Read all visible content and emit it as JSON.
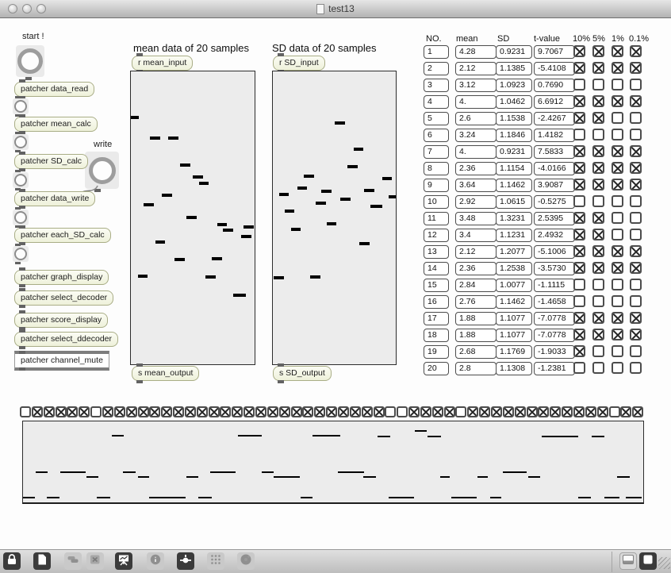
{
  "window": {
    "title": "test13"
  },
  "left": {
    "start_label": "start !",
    "write_label": "write",
    "chain": [
      "patcher data_read",
      "patcher mean_calc",
      "patcher SD_calc",
      "patcher data_write",
      "patcher each_SD_calc"
    ],
    "display": [
      "patcher graph_display",
      "patcher select_decoder",
      "patcher score_display",
      "patcher select_ddecoder",
      "patcher channel_mute"
    ]
  },
  "mean_graph": {
    "title": "mean data of 20 samples",
    "input_box": "r mean_input",
    "output_box": "s mean_output",
    "dashes": [
      [
        0,
        56,
        10
      ],
      [
        24,
        82,
        13
      ],
      [
        47,
        82,
        13
      ],
      [
        62,
        116,
        13
      ],
      [
        78,
        131,
        13
      ],
      [
        86,
        139,
        12
      ],
      [
        39,
        154,
        13
      ],
      [
        16,
        166,
        13
      ],
      [
        70,
        182,
        13
      ],
      [
        109,
        191,
        12
      ],
      [
        116,
        198,
        13
      ],
      [
        142,
        194,
        13
      ],
      [
        139,
        206,
        13
      ],
      [
        31,
        213,
        12
      ],
      [
        55,
        235,
        13
      ],
      [
        102,
        234,
        13
      ],
      [
        9,
        256,
        12
      ],
      [
        94,
        257,
        13
      ],
      [
        129,
        280,
        16
      ]
    ]
  },
  "sd_graph": {
    "title": "SD data of 20 samples",
    "input_box": "r SD_input",
    "output_box": "s SD_output",
    "dashes": [
      [
        78,
        63,
        13
      ],
      [
        102,
        96,
        12
      ],
      [
        94,
        118,
        13
      ],
      [
        39,
        130,
        13
      ],
      [
        138,
        133,
        12
      ],
      [
        31,
        145,
        12
      ],
      [
        61,
        149,
        13
      ],
      [
        115,
        148,
        13
      ],
      [
        8,
        153,
        12
      ],
      [
        146,
        156,
        9
      ],
      [
        85,
        159,
        13
      ],
      [
        54,
        164,
        13
      ],
      [
        123,
        168,
        15
      ],
      [
        15,
        174,
        12
      ],
      [
        68,
        190,
        12
      ],
      [
        23,
        197,
        12
      ],
      [
        109,
        215,
        13
      ],
      [
        1,
        258,
        13
      ],
      [
        47,
        257,
        13
      ]
    ]
  },
  "table": {
    "headers": [
      "NO.",
      "mean",
      "SD",
      "t-value",
      "10%",
      "5%",
      "1%",
      "0.1%"
    ],
    "rows": [
      {
        "no": "1",
        "mean": "4.28",
        "sd": "0.9231",
        "t": "9.7067",
        "checks": [
          1,
          1,
          1,
          1
        ]
      },
      {
        "no": "2",
        "mean": "2.12",
        "sd": "1.1385",
        "t": "-5.4108",
        "checks": [
          1,
          1,
          1,
          1
        ]
      },
      {
        "no": "3",
        "mean": "3.12",
        "sd": "1.0923",
        "t": "0.7690",
        "checks": [
          0,
          0,
          0,
          0
        ]
      },
      {
        "no": "4",
        "mean": "4.",
        "sd": "1.0462",
        "t": "6.6912",
        "checks": [
          1,
          1,
          1,
          1
        ]
      },
      {
        "no": "5",
        "mean": "2.6",
        "sd": "1.1538",
        "t": "-2.4267",
        "checks": [
          1,
          1,
          0,
          0
        ]
      },
      {
        "no": "6",
        "mean": "3.24",
        "sd": "1.1846",
        "t": "1.4182",
        "checks": [
          0,
          0,
          0,
          0
        ]
      },
      {
        "no": "7",
        "mean": "4.",
        "sd": "0.9231",
        "t": "7.5833",
        "checks": [
          1,
          1,
          1,
          1
        ]
      },
      {
        "no": "8",
        "mean": "2.36",
        "sd": "1.1154",
        "t": "-4.0166",
        "checks": [
          1,
          1,
          1,
          1
        ]
      },
      {
        "no": "9",
        "mean": "3.64",
        "sd": "1.1462",
        "t": "3.9087",
        "checks": [
          1,
          1,
          1,
          1
        ]
      },
      {
        "no": "10",
        "mean": "2.92",
        "sd": "1.0615",
        "t": "-0.5275",
        "checks": [
          0,
          0,
          0,
          0
        ]
      },
      {
        "no": "11",
        "mean": "3.48",
        "sd": "1.3231",
        "t": "2.5395",
        "checks": [
          1,
          1,
          0,
          0
        ]
      },
      {
        "no": "12",
        "mean": "3.4",
        "sd": "1.1231",
        "t": "2.4932",
        "checks": [
          1,
          1,
          0,
          0
        ]
      },
      {
        "no": "13",
        "mean": "2.12",
        "sd": "1.2077",
        "t": "-5.1006",
        "checks": [
          1,
          1,
          1,
          1
        ]
      },
      {
        "no": "14",
        "mean": "2.36",
        "sd": "1.2538",
        "t": "-3.5730",
        "checks": [
          1,
          1,
          1,
          1
        ]
      },
      {
        "no": "15",
        "mean": "2.84",
        "sd": "1.0077",
        "t": "-1.1115",
        "checks": [
          0,
          0,
          0,
          0
        ]
      },
      {
        "no": "16",
        "mean": "2.76",
        "sd": "1.1462",
        "t": "-1.4658",
        "checks": [
          0,
          0,
          0,
          0
        ]
      },
      {
        "no": "17",
        "mean": "1.88",
        "sd": "1.1077",
        "t": "-7.0778",
        "checks": [
          1,
          1,
          1,
          1
        ]
      },
      {
        "no": "18",
        "mean": "1.88",
        "sd": "1.1077",
        "t": "-7.0778",
        "checks": [
          1,
          1,
          1,
          1
        ]
      },
      {
        "no": "19",
        "mean": "2.68",
        "sd": "1.1769",
        "t": "-1.9033",
        "checks": [
          1,
          0,
          0,
          0
        ]
      },
      {
        "no": "20",
        "mean": "2.8",
        "sd": "1.1308",
        "t": "-1.2381",
        "checks": [
          0,
          0,
          0,
          0
        ]
      }
    ]
  },
  "bottom": {
    "checkbox_row": [
      0,
      1,
      1,
      1,
      1,
      1,
      0,
      1,
      1,
      1,
      1,
      1,
      1,
      1,
      1,
      1,
      1,
      1,
      1,
      1,
      1,
      1,
      1,
      1,
      1,
      1,
      1,
      1,
      1,
      1,
      1,
      0,
      0,
      1,
      1,
      1,
      1,
      0,
      1,
      1,
      1,
      1,
      1,
      1,
      1,
      1,
      1,
      1,
      1,
      1,
      0,
      1,
      1
    ],
    "dashes": [
      [
        112,
        17,
        15
      ],
      [
        271,
        17,
        30
      ],
      [
        365,
        17,
        35
      ],
      [
        494,
        11,
        15
      ],
      [
        447,
        18,
        16
      ],
      [
        510,
        18,
        17
      ],
      [
        654,
        18,
        46
      ],
      [
        717,
        18,
        16
      ],
      [
        16,
        63,
        15
      ],
      [
        47,
        63,
        32
      ],
      [
        126,
        63,
        16
      ],
      [
        236,
        63,
        32
      ],
      [
        301,
        63,
        15
      ],
      [
        397,
        63,
        33
      ],
      [
        605,
        63,
        30
      ],
      [
        80,
        69,
        15
      ],
      [
        145,
        69,
        14
      ],
      [
        206,
        69,
        15
      ],
      [
        316,
        69,
        33
      ],
      [
        429,
        69,
        16
      ],
      [
        526,
        69,
        12
      ],
      [
        573,
        69,
        13
      ],
      [
        637,
        69,
        15
      ],
      [
        749,
        69,
        16
      ],
      [
        0,
        95,
        15
      ],
      [
        30,
        95,
        16
      ],
      [
        93,
        95,
        17
      ],
      [
        159,
        95,
        46
      ],
      [
        221,
        95,
        17
      ],
      [
        350,
        95,
        15
      ],
      [
        461,
        95,
        32
      ],
      [
        540,
        95,
        32
      ],
      [
        589,
        95,
        14
      ],
      [
        700,
        95,
        16
      ],
      [
        733,
        95,
        19
      ],
      [
        760,
        95,
        20
      ]
    ]
  },
  "toolbar": {
    "left_icons": [
      {
        "name": "lock",
        "enabled": true
      },
      {
        "name": "new-object",
        "enabled": true
      },
      {
        "name": "patch-cords",
        "enabled": false
      },
      {
        "name": "delete",
        "enabled": false
      },
      {
        "name": "presentation",
        "enabled": true
      },
      {
        "name": "info",
        "enabled": false
      },
      {
        "name": "probe",
        "enabled": true
      },
      {
        "name": "grid",
        "enabled": false
      },
      {
        "name": "gauge",
        "enabled": false
      }
    ],
    "right_icons": [
      {
        "name": "window-split",
        "enabled": true
      },
      {
        "name": "inspector",
        "enabled": true
      }
    ]
  },
  "colors": {
    "objbox_border": "#a9ad86",
    "graph_fill": "#ececec",
    "dash": "#000000",
    "titlebar_hi": "#e6e6e6",
    "titlebar_lo": "#b2b2b2"
  }
}
